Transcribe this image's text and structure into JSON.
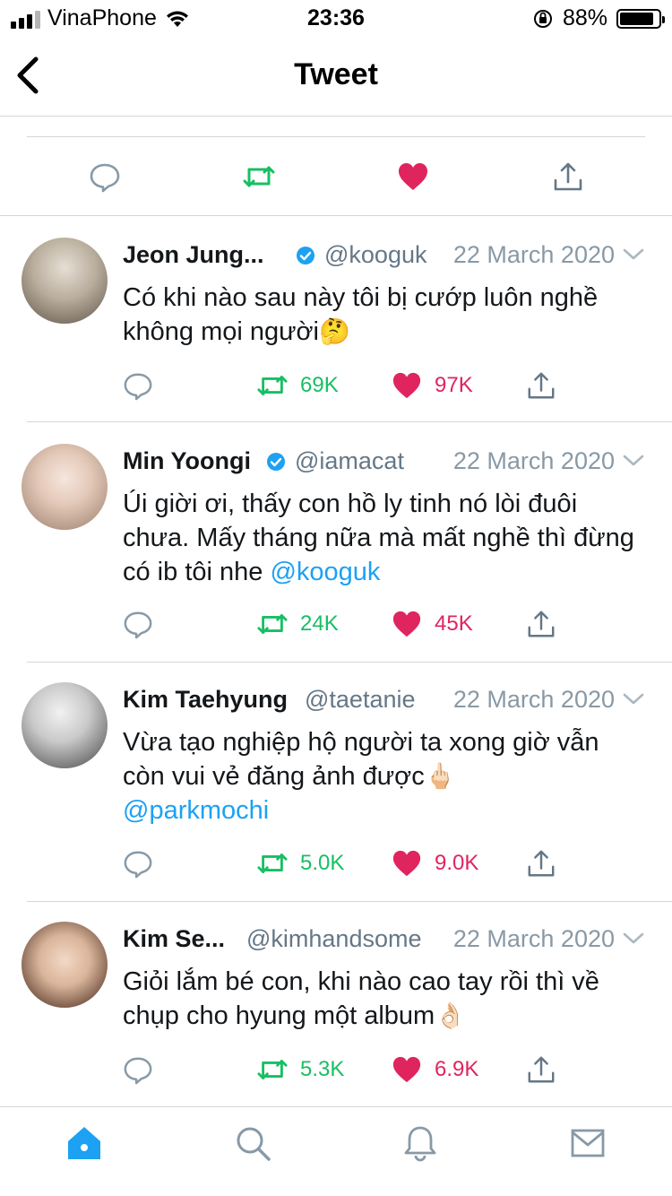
{
  "status_bar": {
    "carrier": "VinaPhone",
    "time": "23:36",
    "battery_percent_label": "88%",
    "battery_level": 0.88
  },
  "header": {
    "title": "Tweet",
    "back_icon": "chevron-left-icon"
  },
  "main_tweet_actions": [
    {
      "name": "reply-icon",
      "color": "#657786"
    },
    {
      "name": "retweet-icon",
      "color": "#17bf63"
    },
    {
      "name": "like-icon",
      "color": "#e0245e"
    },
    {
      "name": "share-icon",
      "color": "#657786"
    }
  ],
  "replies": [
    {
      "name": "Jeon Jung...",
      "verified": true,
      "handle": "@kooguk",
      "date": "22 March 2020",
      "text_parts": [
        "Có khi nào sau này tôi bị cướp luôn nghề không mọi người",
        "🤔"
      ],
      "retweets": "69K",
      "likes": "97K"
    },
    {
      "name": "Min Yoongi",
      "verified": true,
      "handle": "@iamacat",
      "date": "22 March 2020",
      "text_parts": [
        "Úi giời ơi, thấy con hồ ly tinh nó lòi đuôi chưa. Mấy tháng nữa mà mất nghề thì đừng có ib tôi nhe ",
        "@kooguk"
      ],
      "retweets": "24K",
      "likes": "45K"
    },
    {
      "name": "Kim Taehyung",
      "verified": false,
      "handle": "@taetanie",
      "date": "22 March 2020",
      "text_parts": [
        "Vừa tạo nghiệp hộ người ta xong giờ vẫn còn vui vẻ đăng ảnh được",
        "🖕🏻",
        "@parkmochi"
      ],
      "retweets": "5.0K",
      "likes": "9.0K"
    },
    {
      "name": "Kim Se...",
      "verified": false,
      "handle": "@kimhandsome",
      "date": "22 March 2020",
      "text_parts": [
        "Giỏi lắm bé con, khi nào cao tay rồi thì về chụp cho hyung một album",
        "👌🏻"
      ],
      "retweets": "5.3K",
      "likes": "6.9K"
    }
  ],
  "tab_bar": [
    {
      "name": "home-icon",
      "active": true
    },
    {
      "name": "search-icon",
      "active": false
    },
    {
      "name": "notifications-icon",
      "active": false
    },
    {
      "name": "messages-icon",
      "active": false
    }
  ],
  "colors": {
    "accent": "#1da1f2",
    "retweet": "#17bf63",
    "like": "#e0245e",
    "muted": "#657786"
  }
}
